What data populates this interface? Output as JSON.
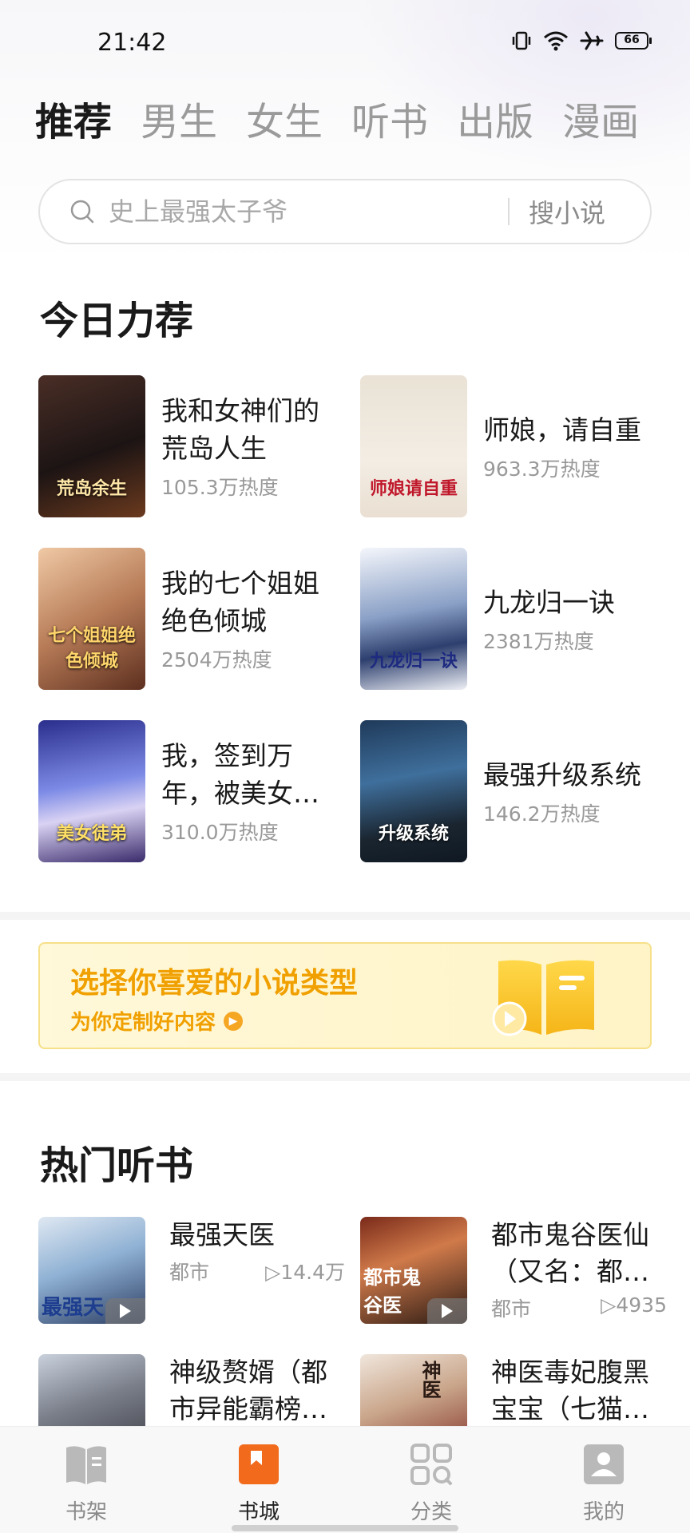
{
  "status": {
    "time": "21:42",
    "battery": "66"
  },
  "tabs": [
    {
      "label": "推荐",
      "active": true
    },
    {
      "label": "男生"
    },
    {
      "label": "女生"
    },
    {
      "label": "听书"
    },
    {
      "label": "出版"
    },
    {
      "label": "漫画"
    }
  ],
  "search": {
    "placeholder": "史上最强太子爷",
    "button": "搜小说"
  },
  "recommend": {
    "title": "今日力荐",
    "items": [
      {
        "title": "我和女神们的荒岛人生",
        "heat": "105.3万热度",
        "cover_text": "荒岛余生"
      },
      {
        "title": "师娘，请自重",
        "heat": "963.3万热度",
        "cover_text": "师娘请自重"
      },
      {
        "title": "我的七个姐姐绝色倾城",
        "heat": "2504万热度",
        "cover_text": "七个姐姐绝色倾城"
      },
      {
        "title": "九龙归一诀",
        "heat": "2381万热度",
        "cover_text": "九龙归一诀"
      },
      {
        "title": "我，签到万年，被美女…",
        "heat": "310.0万热度",
        "cover_text": "美女徒弟"
      },
      {
        "title": "最强升级系统",
        "heat": "146.2万热度",
        "cover_text": "升级系统"
      }
    ]
  },
  "banner": {
    "title": "选择你喜爱的小说类型",
    "subtitle": "为你定制好内容"
  },
  "listen": {
    "title": "热门听书",
    "items": [
      {
        "title": "最强天医",
        "category": "都市",
        "plays": "▷14.4万",
        "cover_text": "最强天"
      },
      {
        "title": "都市鬼谷医仙（又名：都…",
        "category": "都市",
        "plays": "▷4935",
        "cover_text": "都市鬼谷医"
      },
      {
        "title": "神级赘婿（都市异能霸榜…",
        "category": "",
        "plays": "",
        "cover_text": ""
      },
      {
        "title": "神医毒妃腹黑宝宝（七猫…",
        "category": "",
        "plays": "",
        "cover_text": "神医"
      }
    ]
  },
  "nav": [
    {
      "label": "书架",
      "icon": "bookshelf-icon"
    },
    {
      "label": "书城",
      "icon": "bookstore-icon",
      "active": true
    },
    {
      "label": "分类",
      "icon": "category-icon"
    },
    {
      "label": "我的",
      "icon": "profile-icon"
    }
  ]
}
